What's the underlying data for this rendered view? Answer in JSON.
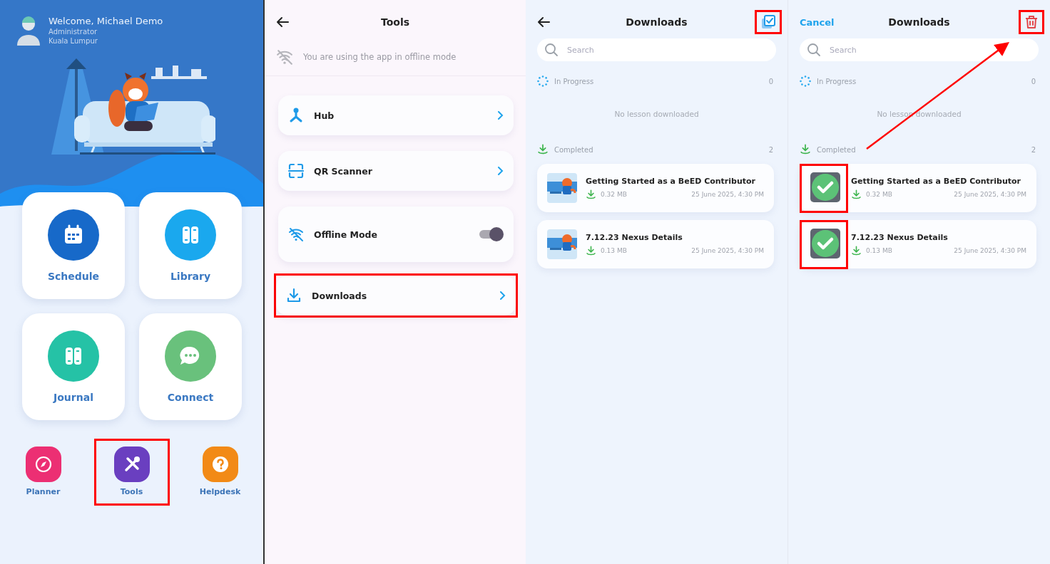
{
  "screens": [
    {
      "kind": "home",
      "user": {
        "greeting": "Welcome, Michael Demo",
        "role": "Administrator",
        "location": "Kuala Lumpur"
      },
      "tiles": [
        {
          "label": "Schedule",
          "color": "#1769c9"
        },
        {
          "label": "Library",
          "color": "#1aa8ee"
        },
        {
          "label": "Journal",
          "color": "#25c2a6"
        },
        {
          "label": "Connect",
          "color": "#69c17c"
        }
      ],
      "apps": [
        {
          "label": "Planner",
          "color": "#ec2f73",
          "highlighted": false
        },
        {
          "label": "Tools",
          "color": "#6a3fc0",
          "highlighted": true
        },
        {
          "label": "Helpdesk",
          "color": "#f28a16",
          "highlighted": false
        }
      ]
    },
    {
      "kind": "tools",
      "title": "Tools",
      "notice": "You are using the app in offline mode",
      "items": [
        {
          "kind": "link",
          "label": "Hub",
          "highlighted": false
        },
        {
          "kind": "link",
          "label": "QR Scanner",
          "highlighted": false
        },
        {
          "kind": "toggle",
          "label": "Offline Mode",
          "on": true,
          "highlighted": false
        },
        {
          "kind": "link",
          "label": "Downloads",
          "highlighted": true
        }
      ]
    },
    {
      "kind": "downloads",
      "selection_mode": false,
      "title": "Downloads",
      "action_highlighted": true,
      "search": {
        "placeholder": "Search"
      },
      "in_progress": {
        "label": "In Progress",
        "count": "0",
        "empty_text": "No lesson downloaded"
      },
      "completed": {
        "label": "Completed",
        "count": "2"
      },
      "items": [
        {
          "title": "Getting Started as a BeED Contributor",
          "size": "0.32 MB",
          "date": "25 June 2025, 4:30 PM"
        },
        {
          "title": "7.12.23 Nexus Details",
          "size": "0.13 MB",
          "date": "25 June 2025, 4:30 PM"
        }
      ]
    },
    {
      "kind": "downloads",
      "selection_mode": true,
      "cancel": "Cancel",
      "title": "Downloads",
      "action_highlighted": true,
      "annotation_arrow": true,
      "search": {
        "placeholder": "Search"
      },
      "in_progress": {
        "label": "In Progress",
        "count": "0",
        "empty_text": "No lesson downloaded"
      },
      "completed": {
        "label": "Completed",
        "count": "2"
      },
      "items": [
        {
          "title": "Getting Started as a BeED Contributor",
          "size": "0.32 MB",
          "date": "25 June 2025, 4:30 PM",
          "selected": true,
          "highlighted": true
        },
        {
          "title": "7.12.23 Nexus Details",
          "size": "0.13 MB",
          "date": "25 June 2025, 4:30 PM",
          "selected": true,
          "highlighted": true
        }
      ]
    }
  ]
}
